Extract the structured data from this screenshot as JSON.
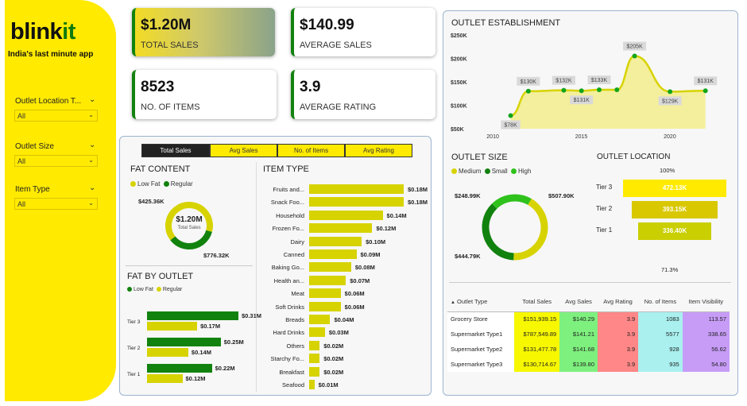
{
  "sidebar": {
    "logo_main": "blink",
    "logo_accent": "it",
    "tagline": "India's last minute app",
    "slicers": [
      {
        "label": "Outlet Location T...",
        "value": "All"
      },
      {
        "label": "Outlet Size",
        "value": "All"
      },
      {
        "label": "Item Type",
        "value": "All"
      }
    ]
  },
  "kpis": [
    {
      "value": "$1.20M",
      "label": "TOTAL SALES"
    },
    {
      "value": "$140.99",
      "label": "AVERAGE SALES"
    },
    {
      "value": "8523",
      "label": "NO. OF ITEMS"
    },
    {
      "value": "3.9",
      "label": "AVERAGE RATING"
    }
  ],
  "tabs": [
    "Total Sales",
    "Avg Sales",
    "No. of Items",
    "Avg Rating"
  ],
  "colors": {
    "yellow": "#ffea00",
    "green": "#12820f",
    "olive": "#d7d300",
    "bright_green": "#2fc11c"
  },
  "fat_content": {
    "title": "FAT CONTENT",
    "legend": [
      "Low Fat",
      "Regular"
    ],
    "center_value": "$1.20M",
    "center_label": "Total Sales",
    "label_top": "$425.36K",
    "label_bottom": "$776.32K",
    "chart_data": {
      "type": "pie",
      "categories": [
        "Low Fat",
        "Regular"
      ],
      "values": [
        776.32,
        425.36
      ]
    }
  },
  "fat_by_outlet": {
    "title": "FAT BY OUTLET",
    "legend": [
      "Low Fat",
      "Regular"
    ],
    "chart_data": {
      "type": "bar",
      "categories": [
        "Tier 3",
        "Tier 2",
        "Tier 1"
      ],
      "series": [
        {
          "name": "Low Fat",
          "values": [
            0.31,
            0.25,
            0.22
          ],
          "labels": [
            "$0.31M",
            "$0.25M",
            "$0.22M"
          ]
        },
        {
          "name": "Regular",
          "values": [
            0.17,
            0.14,
            0.12
          ],
          "labels": [
            "$0.17M",
            "$0.14M",
            "$0.12M"
          ]
        }
      ]
    }
  },
  "item_type": {
    "title": "ITEM TYPE",
    "chart_data": {
      "type": "bar",
      "categories": [
        "Fruits and...",
        "Snack Foo...",
        "Household",
        "Frozen Fo...",
        "Dairy",
        "Canned",
        "Baking Go...",
        "Health an...",
        "Meat",
        "Soft Drinks",
        "Breads",
        "Hard Drinks",
        "Others",
        "Starchy Fo...",
        "Breakfast",
        "Seafood"
      ],
      "values": [
        0.18,
        0.18,
        0.14,
        0.12,
        0.1,
        0.09,
        0.08,
        0.07,
        0.06,
        0.06,
        0.04,
        0.03,
        0.02,
        0.02,
        0.02,
        0.01
      ],
      "labels": [
        "$0.18M",
        "$0.18M",
        "$0.14M",
        "$0.12M",
        "$0.10M",
        "$0.09M",
        "$0.08M",
        "$0.07M",
        "$0.06M",
        "$0.06M",
        "$0.04M",
        "$0.03M",
        "$0.02M",
        "$0.02M",
        "$0.02M",
        "$0.01M"
      ]
    }
  },
  "establishment": {
    "title": "OUTLET ESTABLISHMENT",
    "chart_data": {
      "type": "area",
      "x": [
        2011,
        2012,
        2014,
        2015,
        2016,
        2017,
        2018,
        2020,
        2022
      ],
      "values": [
        78,
        130,
        132,
        131,
        133,
        133,
        205,
        129,
        131
      ],
      "labels": [
        "$78K",
        "$130K",
        "$132K",
        "$131K",
        "$133K",
        "",
        "$205K",
        "$129K",
        "$131K"
      ],
      "yticks": [
        "$250K",
        "$200K",
        "$150K",
        "$100K",
        "$50K"
      ],
      "xticks": [
        "2010",
        "2015",
        "2020"
      ],
      "ylim": [
        50,
        250
      ]
    }
  },
  "outlet_size": {
    "title": "OUTLET SIZE",
    "legend": [
      "Medium",
      "Small",
      "High"
    ],
    "label_left": "$248.99K",
    "label_right": "$507.90K",
    "label_bottom": "$444.79K",
    "chart_data": {
      "type": "pie",
      "categories": [
        "Medium",
        "Small",
        "High"
      ],
      "values": [
        507.9,
        444.79,
        248.99
      ]
    }
  },
  "outlet_location": {
    "title": "OUTLET LOCATION",
    "top_pct": "100%",
    "bottom_pct": "71.3%",
    "chart_data": {
      "type": "bar",
      "categories": [
        "Tier 3",
        "Tier 2",
        "Tier 1"
      ],
      "values": [
        472.13,
        393.15,
        336.4
      ],
      "labels": [
        "472.13K",
        "393.15K",
        "336.40K"
      ]
    }
  },
  "table": {
    "headers": [
      "Outlet Type",
      "Total Sales",
      "Avg Sales",
      "Avg Rating",
      "No. of Items",
      "Item Visibility"
    ],
    "rows": [
      [
        "Grocery Store",
        "$151,939.15",
        "$140.29",
        "3.9",
        "1083",
        "113.57"
      ],
      [
        "Supermarket Type1",
        "$787,549.89",
        "$141.21",
        "3.9",
        "5577",
        "338.65"
      ],
      [
        "Supermarket Type2",
        "$131,477.78",
        "$141.68",
        "3.9",
        "928",
        "56.62"
      ],
      [
        "Supermarket Type3",
        "$130,714.67",
        "$139.80",
        "3.9",
        "935",
        "54.80"
      ]
    ]
  }
}
